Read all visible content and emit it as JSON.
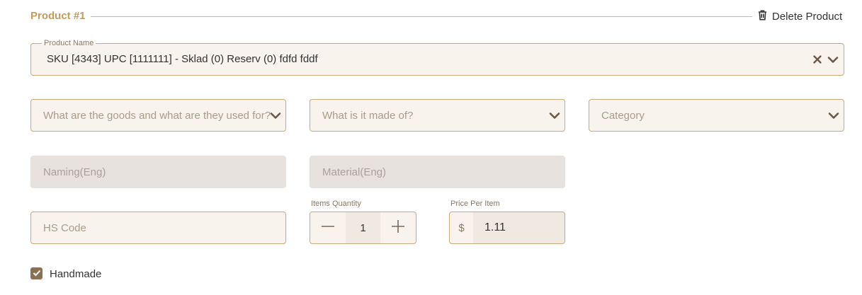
{
  "header": {
    "title": "Product #1",
    "delete_label": "Delete Product"
  },
  "product_name": {
    "legend": "Product Name",
    "value": "SKU [4343] UPC [1111111] - Sklad (0) Reserv (0) fdfd fddf"
  },
  "selects": {
    "goods_placeholder": "What are the goods and what are they used for?",
    "made_of_placeholder": "What is it made of?",
    "category_placeholder": "Category"
  },
  "inputs": {
    "naming_placeholder": "Naming(Eng)",
    "material_placeholder": "Material(Eng)",
    "hs_code_placeholder": "HS Code"
  },
  "quantity": {
    "label": "Items Quantity",
    "value": "1"
  },
  "price": {
    "label": "Price Per Item",
    "currency": "$",
    "value": "1.11"
  },
  "handmade": {
    "label": "Handmade",
    "checked": true
  },
  "colors": {
    "accent": "#c69a5c",
    "border": "#c9a97e",
    "field_bg": "#f8f3ec",
    "disabled_bg": "#e7e2dd",
    "checkbox": "#8b7153"
  }
}
